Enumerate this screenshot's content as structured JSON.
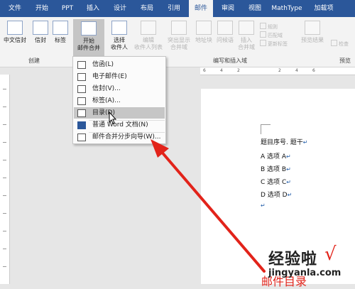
{
  "tabs": [
    "文件",
    "开始",
    "PPT",
    "插入",
    "设计",
    "布局",
    "引用",
    "邮件",
    "审阅",
    "视图",
    "MathType",
    "加载项"
  ],
  "active_tab": "邮件",
  "ribbon": {
    "create_group": {
      "label": "创建",
      "chinese_envelope": "中文信封",
      "envelope": "信封",
      "labels": "标签"
    },
    "start_merge": {
      "start": "开始",
      "start_merge": "邮件合并",
      "select_recipients": "选择",
      "recipients": "收件人",
      "edit": "编辑",
      "edit_list": "收件人列表"
    },
    "write_insert_group": {
      "label": "编写和插入域",
      "highlight_fields": "突出显示",
      "merge_fields": "合并域",
      "address_block": "地址块",
      "greeting_line": "问候语",
      "insert": "插入",
      "merge_field": "合并域",
      "rules": "规则",
      "match_fields": "匹配域",
      "update_labels": "更新标签"
    },
    "preview_group": {
      "label": "预览",
      "preview_results": "预览结果",
      "check": "检查"
    }
  },
  "menu": {
    "items": [
      {
        "label": "信函(L)",
        "icon": "letter-icon"
      },
      {
        "label": "电子邮件(E)",
        "icon": "email-icon"
      },
      {
        "label": "信封(V)...",
        "icon": "envelope-icon"
      },
      {
        "label": "标签(A)...",
        "icon": "label-icon"
      },
      {
        "label": "目录(D)",
        "icon": "directory-icon",
        "highlighted": true
      },
      {
        "label": "普通 Word 文档(N)",
        "icon": "word-doc-icon"
      },
      {
        "label": "邮件合并分步向导(W)...",
        "icon": "wizard-icon"
      }
    ]
  },
  "document": {
    "heading": "题目序号. 题干",
    "options": [
      "A  选项 A",
      "B  选项 B",
      "C  选项 C",
      "D  选项 D"
    ],
    "bottom_text": "邮件目录"
  },
  "ruler_numbers": [
    "6",
    "4",
    "2",
    "2",
    "4",
    "6"
  ],
  "watermark": {
    "line1": "经验啦",
    "line2": "jingyanla.com"
  },
  "colors": {
    "accent": "#2b579a",
    "arrow": "#e2231a"
  }
}
